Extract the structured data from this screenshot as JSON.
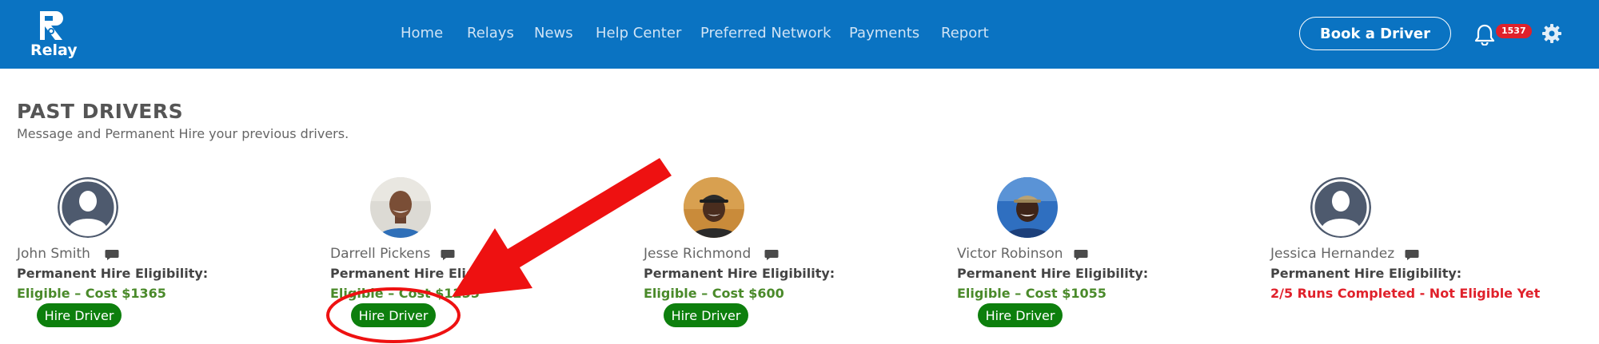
{
  "header": {
    "logo_text": "Relay",
    "nav": [
      "Home",
      "Relays",
      "News",
      "Help Center",
      "Preferred Network",
      "Payments",
      "Report"
    ],
    "book_button": "Book a Driver",
    "notification_count": "1537"
  },
  "page": {
    "title": "PAST DRIVERS",
    "subtitle": "Message and Permanent Hire your previous drivers."
  },
  "drivers": [
    {
      "name": "John Smith",
      "eligibility_label": "Permanent Hire Eligibility:",
      "status": "Eligible – Cost $1365",
      "hire_label": "Hire Driver"
    },
    {
      "name": "Darrell Pickens",
      "eligibility_label": "Permanent Hire Eligibility:",
      "status": "Eligible – Cost $1255",
      "hire_label": "Hire Driver"
    },
    {
      "name": "Jesse Richmond",
      "eligibility_label": "Permanent Hire Eligibility:",
      "status": "Eligible – Cost $600",
      "hire_label": "Hire Driver"
    },
    {
      "name": "Victor Robinson",
      "eligibility_label": "Permanent Hire Eligibility:",
      "status": "Eligible – Cost $1055",
      "hire_label": "Hire Driver"
    },
    {
      "name": "Jessica Hernandez",
      "eligibility_label": "Permanent Hire Eligibility:",
      "status": "2/5 Runs Completed - Not Eligible Yet"
    }
  ],
  "colors": {
    "header_bg": "#0a73c2",
    "eligible_green": "#4a8a2a",
    "not_eligible_red": "#e0212b",
    "hire_button": "#0d7f0d",
    "annotation_red": "#ee1111"
  }
}
